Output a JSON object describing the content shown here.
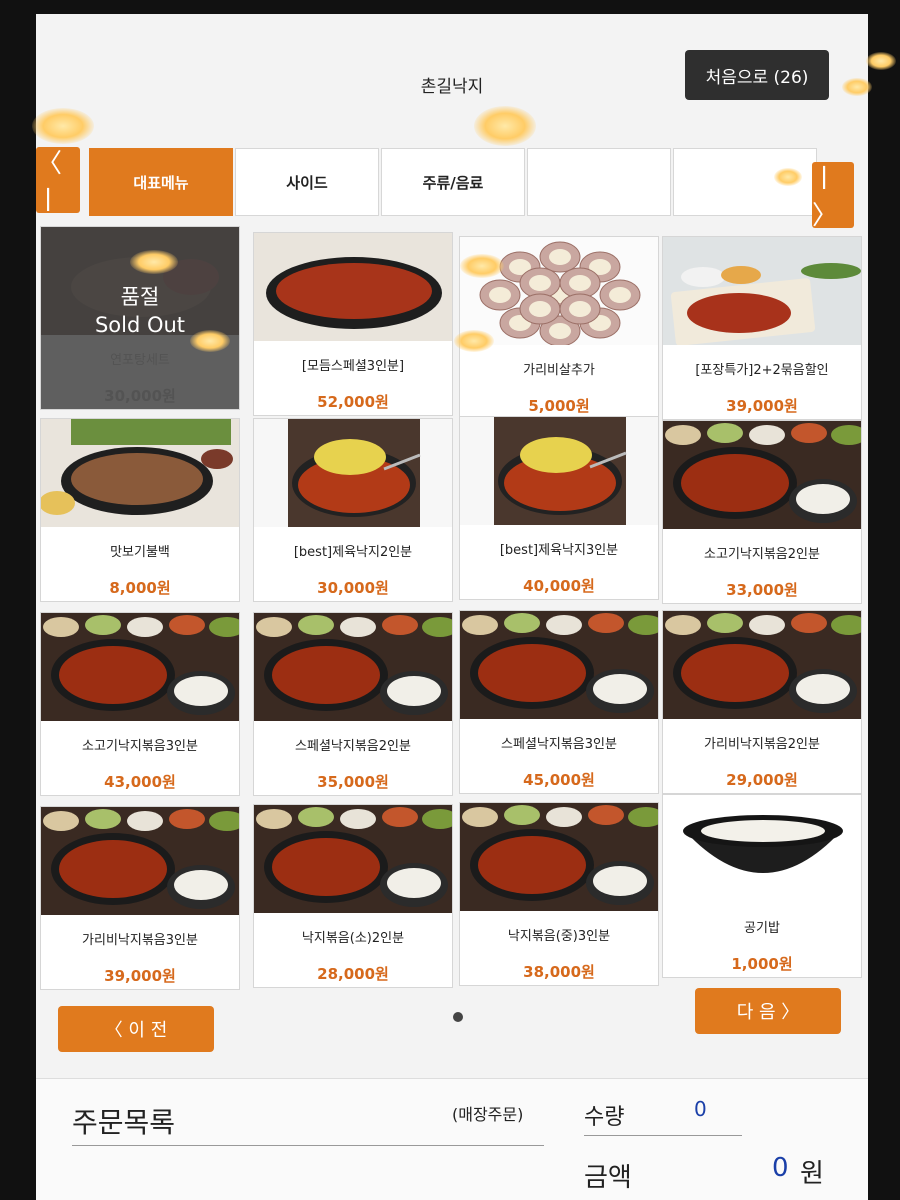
{
  "header": {
    "title": "촌길낙지",
    "home_button": "처음으로 (26)"
  },
  "tabs": {
    "prev_arrow": "〈 ㅣ",
    "next_arrow": "ㅣ 〉",
    "items": [
      {
        "label": "대표메뉴",
        "active": true
      },
      {
        "label": "사이드",
        "active": false
      },
      {
        "label": "주류/음료",
        "active": false
      },
      {
        "label": "",
        "active": false
      },
      {
        "label": "",
        "active": false
      }
    ]
  },
  "menu": {
    "items": [
      {
        "name": "연포탕세트",
        "price": "30,000원",
        "sold_out": true,
        "image": "octopus-soup-set"
      },
      {
        "name": "[모듬스페셜3인분]",
        "price": "52,000원",
        "sold_out": false,
        "image": "spicy-stir-fry-platter"
      },
      {
        "name": "가리비살추가",
        "price": "5,000원",
        "sold_out": false,
        "image": "scallops"
      },
      {
        "name": "[포장특가]2+2묶음할인",
        "price": "39,000원",
        "sold_out": false,
        "image": "takeout-set"
      },
      {
        "name": "맛보기불백",
        "price": "8,000원",
        "sold_out": false,
        "image": "bulbaek"
      },
      {
        "name": "[best]제육낙지2인분",
        "price": "30,000원",
        "sold_out": false,
        "image": "jeyuk-nakji"
      },
      {
        "name": "[best]제육낙지3인분",
        "price": "40,000원",
        "sold_out": false,
        "image": "jeyuk-nakji"
      },
      {
        "name": "소고기낙지볶음2인분",
        "price": "33,000원",
        "sold_out": false,
        "image": "nakji-bokkeum-set"
      },
      {
        "name": "소고기낙지볶음3인분",
        "price": "43,000원",
        "sold_out": false,
        "image": "nakji-bokkeum-set"
      },
      {
        "name": "스페셜낙지볶음2인분",
        "price": "35,000원",
        "sold_out": false,
        "image": "nakji-bokkeum-set"
      },
      {
        "name": "스페셜낙지볶음3인분",
        "price": "45,000원",
        "sold_out": false,
        "image": "nakji-bokkeum-set"
      },
      {
        "name": "가리비낙지볶음2인분",
        "price": "29,000원",
        "sold_out": false,
        "image": "nakji-bokkeum-set"
      },
      {
        "name": "가리비낙지볶음3인분",
        "price": "39,000원",
        "sold_out": false,
        "image": "nakji-bokkeum-set"
      },
      {
        "name": "낙지볶음(소)2인분",
        "price": "28,000원",
        "sold_out": false,
        "image": "nakji-bokkeum-set"
      },
      {
        "name": "낙지볶음(중)3인분",
        "price": "38,000원",
        "sold_out": false,
        "image": "nakji-bokkeum-set"
      },
      {
        "name": "공기밥",
        "price": "1,000원",
        "sold_out": false,
        "image": "rice-bowl"
      }
    ],
    "sold_out_label_ko": "품절",
    "sold_out_label_en": "Sold Out"
  },
  "pager": {
    "prev_label": "〈  이 전",
    "next_label": "다 음  〉"
  },
  "order": {
    "title": "주문목록",
    "order_type": "(매장주문)",
    "qty_label": "수량",
    "qty_value": "0",
    "amount_label": "금액",
    "amount_value": "0",
    "amount_unit": "원"
  },
  "colors": {
    "accent": "#e07a1e",
    "price": "#d6691c",
    "value_blue": "#1a3fa8"
  }
}
